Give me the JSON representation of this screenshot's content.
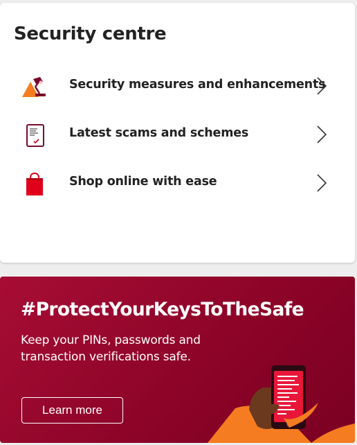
{
  "security_centre": {
    "title": "Security centre",
    "items": [
      {
        "label": "Security measures and enhancements",
        "icon": "desk-lamp-icon"
      },
      {
        "label": "Latest scams and schemes",
        "icon": "document-checklist-icon"
      },
      {
        "label": "Shop online with ease",
        "icon": "shopping-bag-icon"
      }
    ]
  },
  "banner": {
    "title": "#ProtectYourKeysToTheSafe",
    "text": "Keep your PINs, passwords and transaction verifications safe.",
    "button_label": "Learn more",
    "illustration": "hand-holding-phone-illustration"
  },
  "colors": {
    "brand_red": "#8d0428",
    "accent_orange": "#f57c20",
    "text_dark": "#222222"
  }
}
